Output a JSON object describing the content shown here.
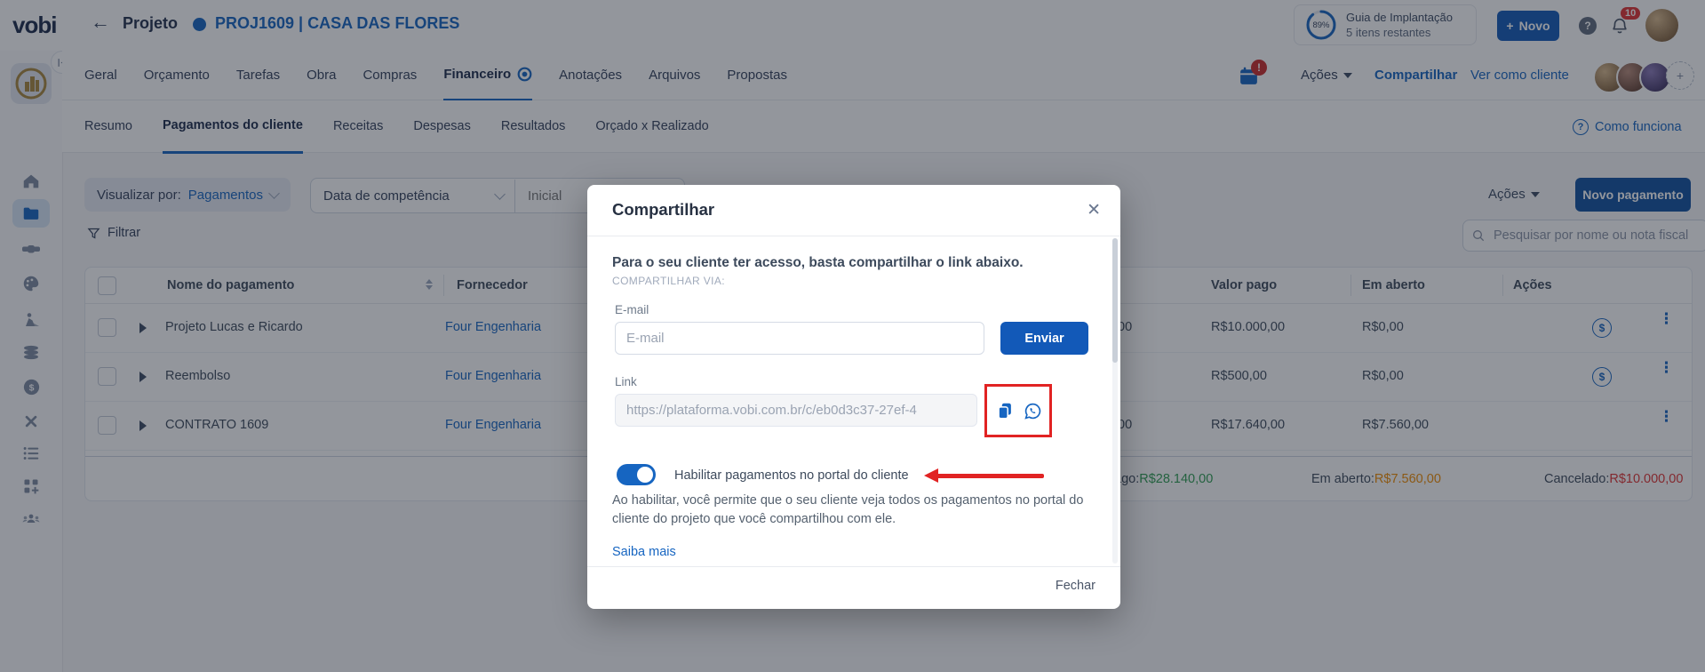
{
  "icons": {
    "back": "←",
    "close": "✕",
    "plus": "+",
    "help": "?",
    "ellipsis": "⋮",
    "dollar": "$",
    "exclaim": "!",
    "avatar_more": "+"
  },
  "colors": {
    "primary_blue": "#1665c1",
    "button_blue": "#1259b8",
    "annotation_red": "#e12323",
    "summary_green": "#2f9e52",
    "summary_orange": "#f08c00",
    "summary_red": "#e03131",
    "logo_gold": "#a8873e"
  },
  "topbar": {
    "logo": "vobi",
    "breadcrumb_label": "Projeto",
    "project_code": "PROJ1609 | CASA DAS FLORES",
    "guide": {
      "percent": "89%",
      "title": "Guia de Implantação",
      "subtitle": "5 itens restantes"
    },
    "new_button": "Novo",
    "notification_count": "10"
  },
  "project_nav": {
    "tabs": [
      {
        "label": "Geral"
      },
      {
        "label": "Orçamento"
      },
      {
        "label": "Tarefas"
      },
      {
        "label": "Obra"
      },
      {
        "label": "Compras"
      },
      {
        "label": "Financeiro"
      },
      {
        "label": "Anotações"
      },
      {
        "label": "Arquivos"
      },
      {
        "label": "Propostas"
      }
    ],
    "calendar_badge": "!",
    "actions_label": "Ações",
    "share_label": "Compartilhar",
    "view_as_client_label": "Ver como cliente"
  },
  "sub_nav": {
    "tabs": [
      {
        "label": "Resumo"
      },
      {
        "label": "Pagamentos do cliente"
      },
      {
        "label": "Receitas"
      },
      {
        "label": "Despesas"
      },
      {
        "label": "Resultados"
      },
      {
        "label": "Orçado x Realizado"
      }
    ],
    "help_label": "Como funciona"
  },
  "filters": {
    "view_by_label": "Visualizar por:",
    "view_by_value": "Pagamentos",
    "date_type_value": "Data de competência",
    "date_start_placeholder": "Inicial",
    "actions_label": "Ações",
    "new_payment_label": "Novo pagamento",
    "search_placeholder": "Pesquisar por nome ou nota fiscal",
    "filter_label": "Filtrar"
  },
  "table": {
    "headers": {
      "name": "Nome do pagamento",
      "supplier": "Fornecedor",
      "paid": "Valor pago",
      "open": "Em aberto",
      "actions": "Ações"
    },
    "rows": [
      {
        "name": "Projeto Lucas e Ricardo",
        "supplier": "Four Engenharia",
        "hidden_fragment": "00",
        "paid": "R$10.000,00",
        "open": "R$0,00"
      },
      {
        "name": "Reembolso",
        "supplier": "Four Engenharia",
        "hidden_fragment": "",
        "paid": "R$500,00",
        "open": "R$0,00"
      },
      {
        "name": "CONTRATO 1609",
        "supplier": "Four Engenharia",
        "hidden_fragment": "00",
        "paid": "R$17.640,00",
        "open": "R$7.560,00"
      }
    ],
    "summary": [
      {
        "label": "ago:",
        "value": "R$28.140,00"
      },
      {
        "label": "Em aberto:",
        "value": "R$7.560,00"
      },
      {
        "label": "Cancelado:",
        "value": "R$10.000,00"
      }
    ]
  },
  "modal": {
    "title": "Compartilhar",
    "intro": "Para o seu cliente ter acesso, basta compartilhar o link abaixo.",
    "share_via": "COMPARTILHAR VIA:",
    "email_label": "E-mail",
    "email_placeholder": "E-mail",
    "send_label": "Enviar",
    "link_label": "Link",
    "link_value": "https://plataforma.vobi.com.br/c/eb0d3c37-27ef-4",
    "toggle_label": "Habilitar pagamentos no portal do cliente",
    "toggle_description": "Ao habilitar, você permite que o seu cliente veja todos os pagamentos no portal do cliente do projeto que você compartilhou com ele.",
    "learn_more": "Saiba mais",
    "close_label": "Fechar"
  }
}
